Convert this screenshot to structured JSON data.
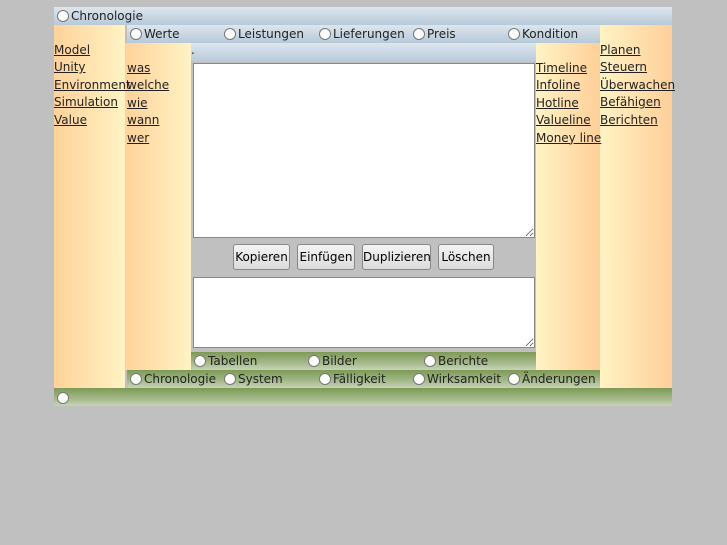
{
  "top_bar": {
    "label": "Chronologie"
  },
  "top_radios": [
    "Werte",
    "Leistungen",
    "Lieferungen",
    "Preis",
    "Kondition"
  ],
  "inner_bar": {
    "label": "."
  },
  "left_links": [
    "Model ",
    "Unity ",
    "Environment",
    "Simulation ",
    "Value "
  ],
  "question_links": [
    "was ",
    "welche",
    "wie",
    "wann",
    "wer"
  ],
  "line_links": [
    "Timeline ",
    "Infoline ",
    "Hotline ",
    "Valueline ",
    "Money line"
  ],
  "action_links": [
    "Planen",
    "Steuern",
    "Überwachen",
    "Befähigen",
    "Berichten"
  ],
  "buttons": {
    "copy": "Kopieren",
    "paste": "Einfügen",
    "duplicate": "Duplizieren",
    "delete": "Löschen"
  },
  "output_radios": [
    "Tabellen",
    "Bilder",
    "Berichte"
  ],
  "bottom_radios": [
    "Chronologie",
    "System",
    "Fälligkeit",
    "Wirksamkeit",
    "Änderungen"
  ],
  "colors": {
    "background": "#c0c0c0",
    "blue_bar": "#b7c9d8",
    "green_bar": "#7d9a55",
    "column": "#ffd29a"
  }
}
